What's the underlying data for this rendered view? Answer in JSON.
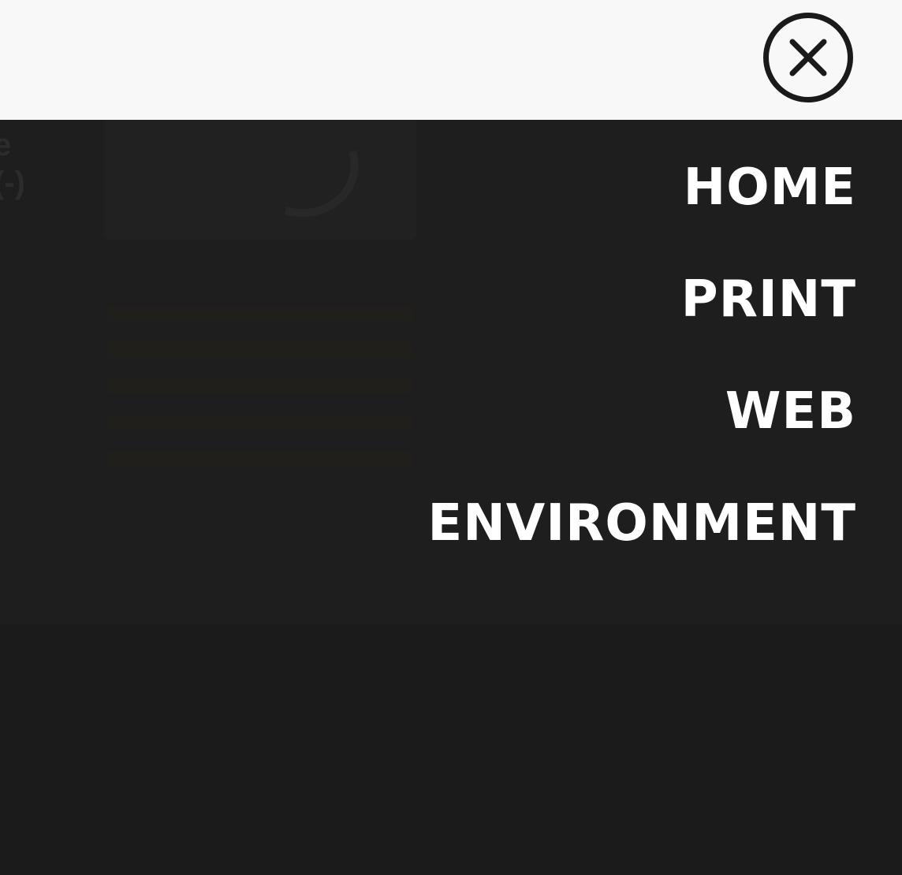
{
  "header": {
    "close_icon": "close-icon"
  },
  "nav": {
    "items": [
      {
        "label": "HOME"
      },
      {
        "label": "PRINT"
      },
      {
        "label": "WEB"
      },
      {
        "label": "ENVIRONMENT"
      }
    ]
  },
  "colors": {
    "header_bg": "#f8f8f8",
    "overlay_bg": "#1b1b1b",
    "nav_text": "#ffffff",
    "close_icon": "#1a1a1a"
  }
}
